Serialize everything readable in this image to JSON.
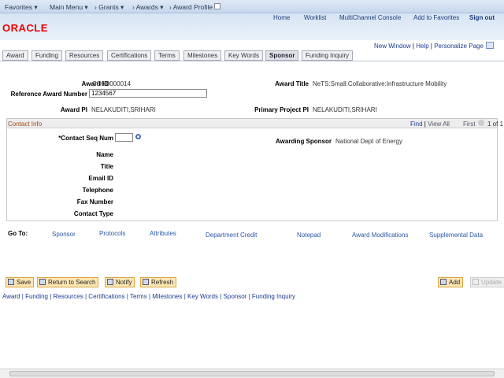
{
  "topbar": {
    "favorites": "Favorites ▾",
    "main_menu": "Main Menu ▾",
    "grants": "› Grants ▾",
    "awards": "› Awards ▾",
    "award_profile": "› Award Profile"
  },
  "header": {
    "logo": "ORACLE",
    "links": [
      "Home",
      "Worklist",
      "MultiChannel Console",
      "Add to Favorites",
      "Sign out"
    ]
  },
  "pagelinks": {
    "new_window": "New Window",
    "help": "Help",
    "personalize": "Personalize Page"
  },
  "tabs": [
    "Award",
    "Funding",
    "Resources",
    "Certifications",
    "Terms",
    "Milestones",
    "Key Words",
    "Sponsor",
    "Funding Inquiry"
  ],
  "active_tab": "Sponsor",
  "form": {
    "award_id_label": "Award ID",
    "award_id": "CON0000014",
    "award_title_label": "Award Title",
    "award_title": "NeTS:Small:Collaborative:Infrastructure Mobility",
    "ref_label": "Reference Award Number",
    "ref_value": "1234567",
    "award_pi_label": "Award PI",
    "award_pi": "NELAKUDITI,SRIHARI",
    "primary_pi_label": "Primary Project PI",
    "primary_pi": "NELAKUDITI,SRIHARI"
  },
  "contact": {
    "title": "Contact Info",
    "find": "Find",
    "view_all": "View All",
    "first": "First",
    "count": "1 of 1",
    "seq_label": "*Contact Seq Num",
    "seq_value": "",
    "sponsor_label": "Awarding Sponsor",
    "sponsor": "National Dept of Energy",
    "fields": [
      "Name",
      "Title",
      "Email ID",
      "Telephone",
      "Fax Number",
      "Contact Type"
    ]
  },
  "goto": {
    "label": "Go To:",
    "links": [
      "Sponsor",
      "Protocols",
      "Attributes",
      "Department Credit",
      "Notepad",
      "Award Modifications",
      "Supplemental Data"
    ]
  },
  "buttons": {
    "save": "Save",
    "return": "Return to Search",
    "notify": "Notify",
    "refresh": "Refresh",
    "add": "Add",
    "update": "Update"
  },
  "footer_links": [
    "Award",
    "Funding",
    "Resources",
    "Certifications",
    "Terms",
    "Milestones",
    "Key Words",
    "Sponsor",
    "Funding Inquiry"
  ]
}
